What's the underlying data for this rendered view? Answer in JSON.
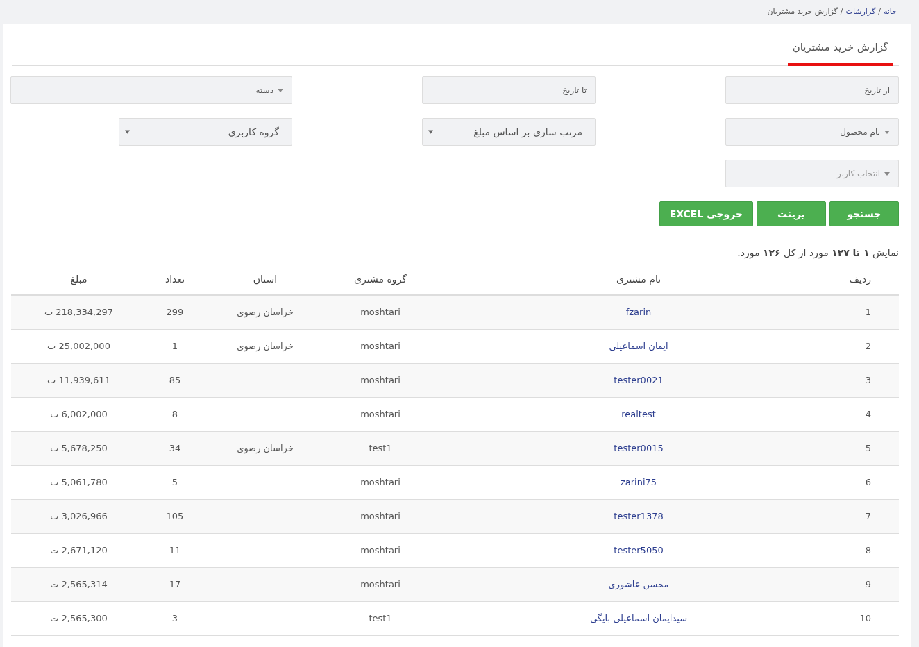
{
  "breadcrumb_separator": "/",
  "breadcrumb": [
    {
      "label": "خانه",
      "kind": "link"
    },
    {
      "label": "گزارشات",
      "kind": "link"
    },
    {
      "label": "گزارش خرید مشتریان",
      "kind": "current"
    }
  ],
  "tabs": [
    {
      "label": "گزارش خرید مشتریان",
      "selected": true
    }
  ],
  "filter_rows": [
    [
      {
        "kind": "date",
        "placeholder": "از تاریخ"
      },
      {
        "kind": "date",
        "placeholder": "تا تاریخ"
      },
      {
        "kind": "select2",
        "value": "دسته"
      }
    ],
    [
      {
        "kind": "select2",
        "value": "نام محصول"
      },
      {
        "kind": "native",
        "value": "مرتب سازی بر اساس مبلغ"
      },
      {
        "kind": "native",
        "value": "گروه کاربری"
      }
    ],
    [
      {
        "kind": "select2",
        "placeholder": "انتخاب کاربر"
      }
    ]
  ],
  "buttons": [
    "جستجو",
    "پرینت",
    "خروجی EXCEL"
  ],
  "summary": "نمایش **۱ تا ۱۲۷** مورد از کل **۱۲۶** مورد.",
  "table": {
    "columns": [
      "ردیف",
      "نام مشتری",
      "گروه مشتری",
      "استان",
      "تعداد",
      "مبلغ"
    ],
    "rows": [
      [
        "1",
        "fzarin",
        "moshtari",
        "خراسان رضوی",
        "299",
        "218,334,297 ت"
      ],
      [
        "2",
        "ایمان اسماعیلی",
        "moshtari",
        "خراسان رضوی",
        "1",
        "25,002,000 ت"
      ],
      [
        "3",
        "tester0021",
        "moshtari",
        "",
        "85",
        "11,939,611 ت"
      ],
      [
        "4",
        "realtest",
        "moshtari",
        "",
        "8",
        "6,002,000 ت"
      ],
      [
        "5",
        "tester0015",
        "test1",
        "خراسان رضوی",
        "34",
        "5,678,250 ت"
      ],
      [
        "6",
        "zarini75",
        "moshtari",
        "",
        "5",
        "5,061,780 ت"
      ],
      [
        "7",
        "tester1378",
        "moshtari",
        "",
        "105",
        "3,026,966 ت"
      ],
      [
        "8",
        "tester5050",
        "moshtari",
        "",
        "11",
        "2,671,120 ت"
      ],
      [
        "9",
        "محسن عاشوری",
        "moshtari",
        "",
        "17",
        "2,565,314 ت"
      ],
      [
        "10",
        "سیدایمان اسماعیلی بایگی",
        "test1",
        "",
        "3",
        "2,565,300 ت"
      ]
    ]
  }
}
